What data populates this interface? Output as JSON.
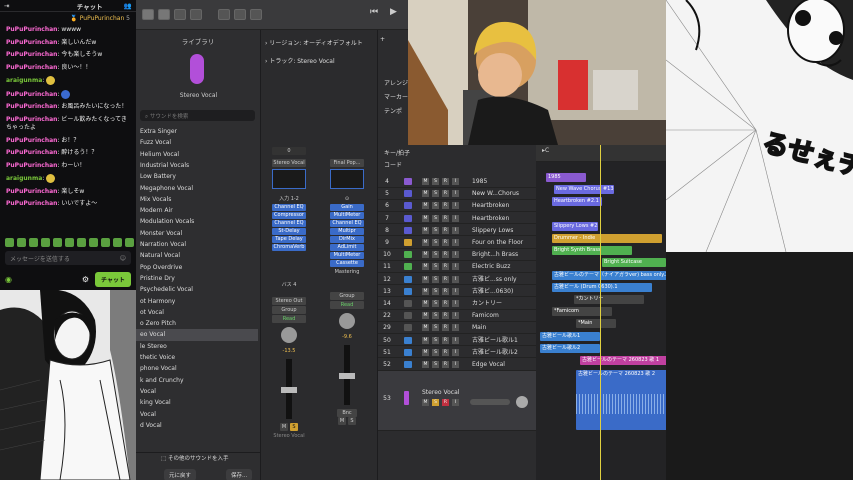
{
  "chat": {
    "title": "チャット",
    "pinned_user": "PuPuPurinchan",
    "pinned_count": "5",
    "messages": [
      {
        "user": "PuPuPurinchan",
        "text": "wwww",
        "color": "#ff6ad5"
      },
      {
        "user": "PuPuPurinchan",
        "text": "楽しいんだw",
        "color": "#ff6ad5"
      },
      {
        "user": "PuPuPurinchan",
        "text": "今も楽しそうw",
        "color": "#ff6ad5"
      },
      {
        "user": "PuPuPurinchan",
        "text": "良い～！！",
        "color": "#ff6ad5"
      },
      {
        "user": "araigunma",
        "text": "",
        "color": "#7ac83a"
      },
      {
        "user": "PuPuPurinchan",
        "text": "",
        "color": "#ff6ad5"
      },
      {
        "user": "PuPuPurinchan",
        "text": "お風呂みたいになった！",
        "color": "#ff6ad5"
      },
      {
        "user": "PuPuPurinchan",
        "text": "ビール飲みたくなってきちゃったよ",
        "color": "#ff6ad5"
      },
      {
        "user": "PuPuPurinchan",
        "text": "お！？",
        "color": "#ff6ad5"
      },
      {
        "user": "PuPuPurinchan",
        "text": "酔けるう！？",
        "color": "#ff6ad5"
      },
      {
        "user": "PuPuPurinchan",
        "text": "わーい！",
        "color": "#ff6ad5"
      },
      {
        "user": "araigunma",
        "text": "",
        "color": "#7ac83a"
      },
      {
        "user": "PuPuPurinchan",
        "text": "楽しそw",
        "color": "#ff6ad5"
      },
      {
        "user": "PuPuPurinchan",
        "text": "いいですよ～",
        "color": "#ff6ad5"
      }
    ],
    "input_placeholder": "メッセージを送信する",
    "send_label": "チャット"
  },
  "library": {
    "title": "ライブラリ",
    "selected_patch": "Stereo Vocal",
    "search_placeholder": "サウンドを検索",
    "items": [
      "Extra Singer",
      "Fuzz Vocal",
      "Helium Vocal",
      "Industrial Vocals",
      "Low Battery",
      "Megaphone Vocal",
      "Mix Vocals",
      "Modern Air",
      "Modulation Vocals",
      "Monster Vocal",
      "Narration Vocal",
      "Natural Vocal",
      "Pop Overdrive",
      "Pristine Dry",
      "Psychedelic Vocal",
      "ot Harmony",
      "ot Vocal",
      "o Zero Pitch",
      "eo Vocal",
      "le Stereo",
      "thetic Voice",
      "phone Vocal",
      "k and Crunchy",
      "Vocal",
      "king Vocal",
      "Vocal",
      "d Vocal"
    ],
    "selected_index": 18,
    "other_sounds": "その他のサウンドを入手",
    "revert_label": "元に戻す",
    "save_label": "保存..."
  },
  "inspector": {
    "region_label": "リージョン: オーディオデフォルト",
    "track_label": "トラック: Stereo Vocal",
    "strip1": {
      "value": "0",
      "setting": "Stereo Vocal",
      "input": "入力 1-2",
      "plugins": [
        "Channel EQ",
        "Compressor",
        "Channel EQ",
        "St-Delay",
        "Tape Delay",
        "ChromaVerb"
      ],
      "bus": "バス 4",
      "output": "Stereo Out",
      "group": "Group",
      "auto": "Read",
      "pan_value": "-13.5",
      "name": "Stereo Vocal"
    },
    "strip2": {
      "setting": "Final Pop...",
      "plugins": [
        "Gain",
        "MultiMeter",
        "Channel EQ",
        "Multipr",
        "DirMix",
        "AdLimit",
        "MultiMeter",
        "Cassette"
      ],
      "mode": "Mastering",
      "group": "Group",
      "auto": "Read",
      "pan_value": "-9.6",
      "bounce": "Bnc",
      "name": "Final Pop"
    }
  },
  "tracks_header": {
    "key_label": "キー/拍子",
    "chord_label": "コード",
    "arrange_label": "アレンジ",
    "marker_label": "マーカー",
    "tempo_label": "テンポ",
    "ruler_value": "C"
  },
  "tracks": [
    {
      "num": "4",
      "name": "1985",
      "color": "#8a5ad0"
    },
    {
      "num": "5",
      "name": "New W...Chorus",
      "color": "#5a5ad0"
    },
    {
      "num": "6",
      "name": "Heartbroken",
      "color": "#5a5ad0"
    },
    {
      "num": "7",
      "name": "Heartbroken",
      "color": "#5a5ad0"
    },
    {
      "num": "8",
      "name": "Slippery Lows",
      "color": "#5a5ad0"
    },
    {
      "num": "9",
      "name": "Four on the Floor",
      "color": "#d0a030"
    },
    {
      "num": "10",
      "name": "Bright...h Brass",
      "color": "#50b050"
    },
    {
      "num": "11",
      "name": "Electric Buzz",
      "color": "#50b050"
    },
    {
      "num": "12",
      "name": "古雅ビ...ss only",
      "color": "#3a80d0"
    },
    {
      "num": "13",
      "name": "古雅ビ...0630)",
      "color": "#3a80d0"
    },
    {
      "num": "14",
      "name": "カントリー",
      "color": "#555"
    },
    {
      "num": "22",
      "name": "Famicom",
      "color": "#555"
    },
    {
      "num": "29",
      "name": "Main",
      "color": "#555"
    },
    {
      "num": "50",
      "name": "古雅ビール歌ル1",
      "color": "#3a80d0"
    },
    {
      "num": "51",
      "name": "古雅ビール歌ル2",
      "color": "#3a80d0"
    },
    {
      "num": "52",
      "name": "Edge Vocal",
      "color": "#3a80d0"
    },
    {
      "num": "53",
      "name": "Stereo Vocal",
      "color": "#b24fd9"
    }
  ],
  "regions": [
    {
      "row": 0,
      "text": "1985",
      "color": "#8a5ad0"
    },
    {
      "row": 1,
      "text": "New Wave Chorus #13.1",
      "color": "#6a6ae0"
    },
    {
      "row": 2,
      "text": "Heartbroken #2.1",
      "color": "#6a6ae0"
    },
    {
      "row": 4,
      "text": "Slippery Lows #2.1",
      "color": "#6a6ae0"
    },
    {
      "row": 5,
      "text": "Drummer - Indie",
      "color": "#d0a030"
    },
    {
      "row": 6,
      "text": "Bright Synth Brass",
      "color": "#50b050"
    },
    {
      "row": 7,
      "text": "Bright Suitcase",
      "color": "#50b050"
    },
    {
      "row": 8,
      "text": "古雅ビールのテーマ（ナイアガラver) bass only.2",
      "color": "#3a80d0"
    },
    {
      "row": 9,
      "text": "古雅ビール (Drum 0630).1",
      "color": "#3a80d0"
    },
    {
      "row": 10,
      "text": "*カントリー",
      "color": "#444"
    },
    {
      "row": 11,
      "text": "*Famicom",
      "color": "#444"
    },
    {
      "row": 12,
      "text": "*Main",
      "color": "#444"
    },
    {
      "row": 13,
      "text": "古雅ビール歌ル1",
      "color": "#3a80d0"
    },
    {
      "row": 14,
      "text": "古雅ビール歌ル2",
      "color": "#3a80d0"
    },
    {
      "row": 15,
      "text": "古雅ビールのテーマ 260823 歌 1",
      "color": "#c040a0"
    },
    {
      "row": 16,
      "text": "古雅ビールのテーマ 260823 歌 2",
      "color": "#3a80d0"
    }
  ],
  "manga2_text": "るせぇチェラス！！"
}
